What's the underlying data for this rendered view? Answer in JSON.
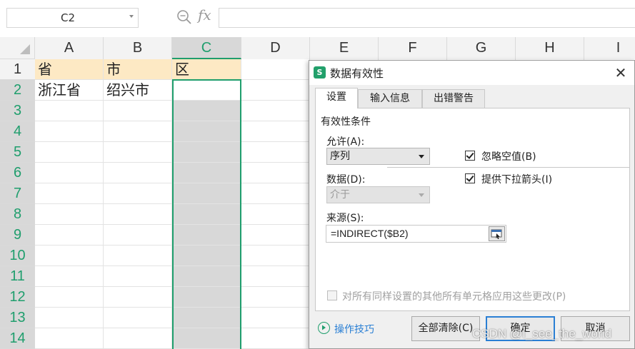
{
  "formula_bar": {
    "name_box": "C2",
    "fx_label": "fx",
    "formula": ""
  },
  "grid": {
    "columns": [
      "A",
      "B",
      "C",
      "D",
      "E",
      "F",
      "G",
      "H",
      "I"
    ],
    "rows": [
      "1",
      "2",
      "3",
      "4",
      "5",
      "6",
      "7",
      "8",
      "9",
      "10",
      "11",
      "12",
      "13",
      "14"
    ],
    "cells": {
      "A1": "省",
      "B1": "市",
      "C1": "区",
      "A2": "浙江省",
      "B2": "绍兴市"
    },
    "selected_column": "C",
    "active_cell": "C2"
  },
  "dialog": {
    "title": "数据有效性",
    "close_glyph": "✕",
    "tabs": [
      "设置",
      "输入信息",
      "出错警告"
    ],
    "active_tab": "设置",
    "group_title": "有效性条件",
    "allow_label": "允许(A):",
    "allow_value": "序列",
    "data_label": "数据(D):",
    "data_value": "介于",
    "ignore_blank_label": "忽略空值(B)",
    "ignore_blank_checked": true,
    "dropdown_label": "提供下拉箭头(I)",
    "dropdown_checked": true,
    "source_label": "来源(S):",
    "source_value": "=INDIRECT($B2)",
    "apply_all_label": "对所有同样设置的其他所有单元格应用这些更改(P)",
    "apply_all_checked": false,
    "tips_label": "操作技巧",
    "clear_all_button": "全部清除(C)",
    "ok_button": "确定",
    "cancel_button": "取消"
  },
  "watermark": "CSDN @I_see_the_world",
  "colors": {
    "accent_green": "#1f9e6d",
    "header_row_fill": "#fde9c4",
    "link_blue": "#2a7fd4"
  },
  "icons": [
    "dropdown-arrow-icon",
    "zoom-icon",
    "fx-icon",
    "select-all-icon",
    "wps-logo-icon",
    "close-icon",
    "range-picker-icon",
    "play-circle-icon"
  ]
}
